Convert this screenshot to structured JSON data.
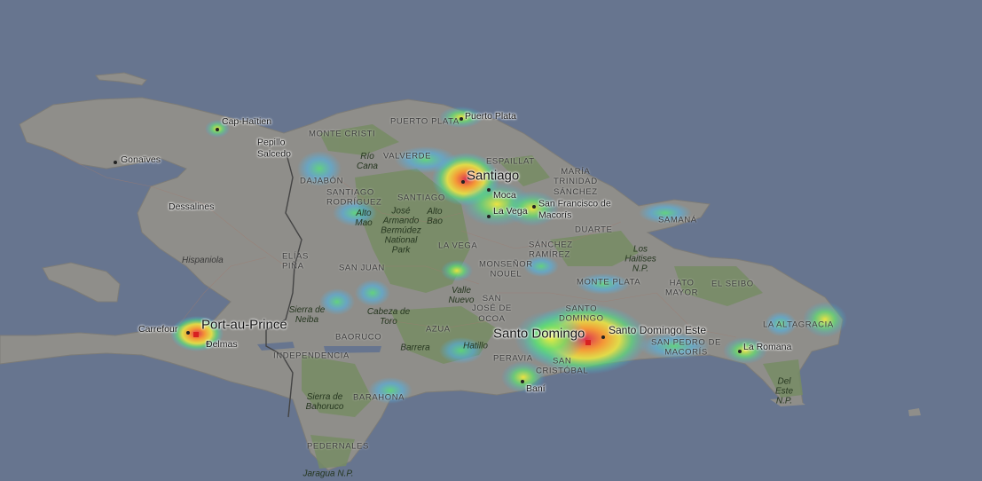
{
  "colors": {
    "sea": "#67758f",
    "land": "#8f8e8a",
    "forest": "#778c64",
    "border": "#444444"
  },
  "cities": [
    {
      "id": "santo-domingo",
      "name": "Santo Domingo",
      "size": "big"
    },
    {
      "id": "santo-domingo-este",
      "name": "Santo Domingo Este",
      "size": "mid"
    },
    {
      "id": "port-au-prince",
      "name": "Port-au-Prince",
      "size": "big"
    },
    {
      "id": "santiago",
      "name": "Santiago",
      "size": "big"
    },
    {
      "id": "puerto-plata",
      "name": "Puerto Plata",
      "size": "sm"
    },
    {
      "id": "cap-haitien",
      "name": "Cap-Haïtien",
      "size": "sm"
    },
    {
      "id": "gonaives",
      "name": "Gonaïves",
      "size": "sm"
    },
    {
      "id": "pepillo-salcedo",
      "name": "Pepillo\nSalcedo",
      "size": "sm"
    },
    {
      "id": "dessalines",
      "name": "Dessalines",
      "size": "sm"
    },
    {
      "id": "carrefour",
      "name": "Carrefour",
      "size": "sm"
    },
    {
      "id": "delmas",
      "name": "Delmas",
      "size": "sm"
    },
    {
      "id": "moca",
      "name": "Moca",
      "size": "sm"
    },
    {
      "id": "la-vega",
      "name": "La Vega",
      "size": "sm"
    },
    {
      "id": "san-francisco-de-macoris",
      "name": "San Francisco de\nMacorís",
      "size": "sm"
    },
    {
      "id": "la-romana",
      "name": "La Romana",
      "size": "sm"
    },
    {
      "id": "bani",
      "name": "Baní",
      "size": "sm"
    }
  ],
  "provinces": [
    "PUERTO PLATA",
    "MONTE CRISTI",
    "VALVERDE",
    "ESPAILLAT",
    "MARÍA\nTRINIDAD\nSÁNCHEZ",
    "DAJABÓN",
    "SANTIAGO\nRODRÍGUEZ",
    "SANTIAGO",
    "DUARTE",
    "SAMANÁ",
    "LA VEGA",
    "SÁNCHEZ\nRAMÍREZ",
    "ELÍAS\nPIÑA",
    "SAN JUAN",
    "MONSEÑOR\nNOUEL",
    "MONTE PLATA",
    "HATO\nMAYOR",
    "EL SEIBO",
    "LA ALTAGRACIA",
    "SAN\nJOSÉ DE\nOCOA",
    "AZUA",
    "BAORUCO",
    "INDEPENDENCIA",
    "PERAVIA",
    "SAN\nCRISTÓBAL",
    "SAN PEDRO DE\nMACORÍS",
    "BARAHONA",
    "PEDERNALES",
    "SANTO\nDOMINGO"
  ],
  "parks": [
    "Río\nCana",
    "José\nArmando\nBermúdez\nNational\nPark",
    "Alto\nMao",
    "Alto\nBao",
    "Los\nHaitises\nN.P.",
    "Valle\nNuevo",
    "Sierra de\nNeiba",
    "Cabeza de\nToro",
    "Barrera",
    "Hatillo",
    "Sierra de\nBahoruco",
    "Jaragua N.P.",
    "Del\nEste\nN.P."
  ],
  "regions": [
    "Hispaniola"
  ]
}
